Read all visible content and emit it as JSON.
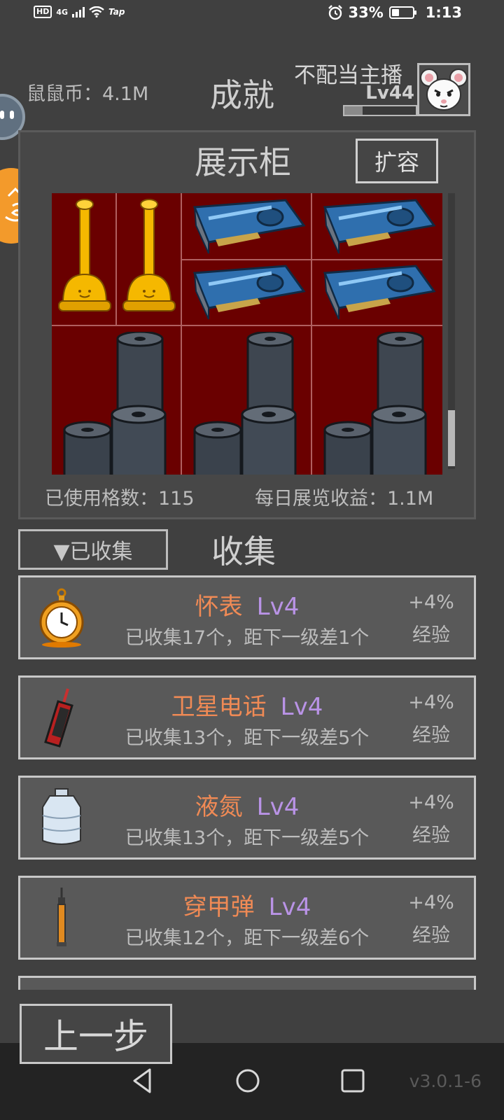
{
  "status_bar": {
    "network": "HD",
    "signal": "4G",
    "app_badge": "Tap",
    "battery": "33%",
    "time": "1:13"
  },
  "header": {
    "coins_label": "鼠鼠币：4.1M",
    "title": "成就",
    "player_name": "不配当主播",
    "player_level": "Lv44",
    "xp_progress": 0.25
  },
  "showcase": {
    "title": "展示柜",
    "expand_label": "扩容",
    "items": [
      "trophy",
      "trophy",
      "graphics-card",
      "graphics-card",
      "graphics-card",
      "graphics-card",
      "steel-rolls",
      "steel-rolls",
      "steel-rolls"
    ],
    "used_cells": "已使用格数：115",
    "daily_income": "每日展览收益：1.1M"
  },
  "collection": {
    "filter_label": "▼已收集",
    "title": "收集",
    "cards": [
      {
        "name": "怀表",
        "level": "Lv4",
        "progress": "已收集17个，距下一级差1个",
        "bonus": "+4%",
        "bonus_type": "经验",
        "icon": "pocket-watch-icon"
      },
      {
        "name": "卫星电话",
        "level": "Lv4",
        "progress": "已收集13个，距下一级差5个",
        "bonus": "+4%",
        "bonus_type": "经验",
        "icon": "satellite-phone-icon"
      },
      {
        "name": "液氮",
        "level": "Lv4",
        "progress": "已收集13个，距下一级差5个",
        "bonus": "+4%",
        "bonus_type": "经验",
        "icon": "liquid-nitrogen-icon"
      },
      {
        "name": "穿甲弹",
        "level": "Lv4",
        "progress": "已收集12个，距下一级差6个",
        "bonus": "+4%",
        "bonus_type": "经验",
        "icon": "ap-round-icon"
      }
    ]
  },
  "footer": {
    "back_label": "上一步",
    "version": "v3.0.1-6"
  },
  "colors": {
    "background": "#404040",
    "item_name": "#f08a55",
    "item_level": "#b993e6",
    "showcase_bg": "#6a0000"
  }
}
